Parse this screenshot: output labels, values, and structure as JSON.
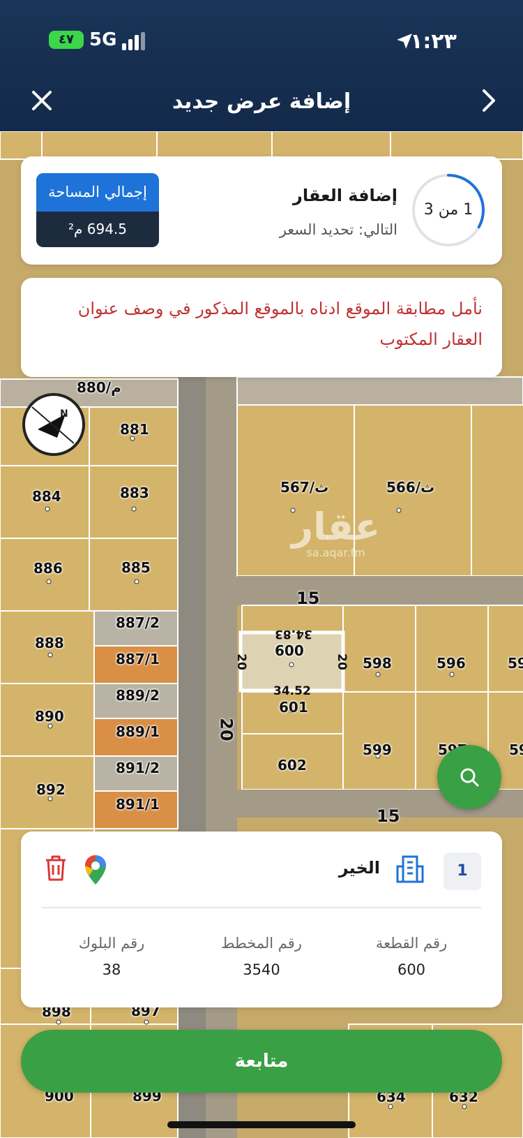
{
  "status_bar": {
    "time": "١:٢٣",
    "battery": "٤٧",
    "network": "5G"
  },
  "nav": {
    "title": "إضافة عرض جديد"
  },
  "step": {
    "progress": "1 من 3",
    "progress_fraction": 0.33,
    "title": "إضافة العقار",
    "next": "التالي: تحديد السعر"
  },
  "area": {
    "label": "إجمالي المساحة",
    "value": "694.5 م²"
  },
  "note": {
    "text": "نأمل مطابقة الموقع ادناه بالموقع المذكور في وصف عنوان العقار المكتوب"
  },
  "map": {
    "watermark": {
      "brand": "عقار",
      "url": "sa.aqar.fm"
    },
    "plots": [
      "880/م",
      "881",
      "884",
      "883",
      "886",
      "885",
      "887/2",
      "888",
      "887/1",
      "889/2",
      "890",
      "889/1",
      "891/2",
      "892",
      "891/1",
      "567/ث",
      "566/ث",
      "600",
      "598",
      "596",
      "59",
      "601",
      "599",
      "597",
      "59",
      "602",
      "898",
      "897",
      "900",
      "899",
      "634",
      "632"
    ],
    "roads": [
      "15",
      "20",
      "15"
    ],
    "dimensions": [
      "34.83",
      "34.52",
      "20",
      "20"
    ],
    "icons": {
      "compass": "compass-icon",
      "zoom": "search-icon"
    }
  },
  "property": {
    "index": "1",
    "district": "الخير",
    "plot_label": "رقم القطعة",
    "plot_value": "600",
    "plan_label": "رقم المخطط",
    "plan_value": "3540",
    "block_label": "رقم البلوك",
    "block_value": "38",
    "icons": {
      "building": "building-icon",
      "maps": "google-maps-icon",
      "delete": "trash-icon"
    }
  },
  "actions": {
    "continue": "متابعة"
  },
  "colors": {
    "accent_green": "#3aa046",
    "accent_blue": "#1e73d8",
    "warning_red": "#c13232",
    "header_bg": "#13294a"
  }
}
